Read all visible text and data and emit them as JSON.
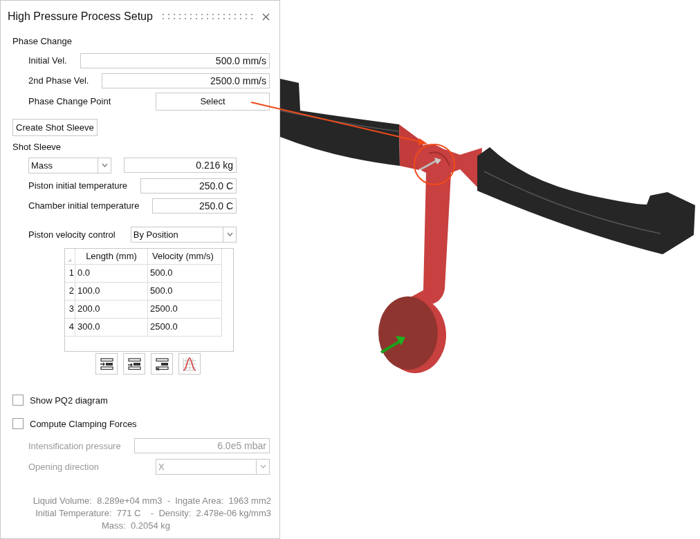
{
  "window": {
    "title": "High Pressure Process Setup"
  },
  "phase_change": {
    "heading": "Phase Change",
    "fields": [
      {
        "label": "Initial Vel.",
        "value": "500.0 mm/s"
      },
      {
        "label": "2nd Phase Vel.",
        "value": "2500.0 mm/s"
      }
    ],
    "point": {
      "label": "Phase Change Point",
      "button": "Select"
    }
  },
  "create_button": "Create Shot Sleeve",
  "shot_sleeve": {
    "heading": "Shot Sleeve",
    "mode": "Mass",
    "mode_value": "0.216 kg",
    "fields": [
      {
        "label": "Piston initial temperature",
        "value": "250.0 C"
      },
      {
        "label": "Chamber initial temperature",
        "value": "250.0 C"
      }
    ],
    "velocity_control": {
      "label": "Piston velocity control",
      "value": "By Position"
    },
    "table": {
      "columns": [
        "Length (mm)",
        "Velocity (mm/s)"
      ],
      "rows": [
        {
          "index": "1",
          "cells": [
            "0.0",
            "500.0"
          ]
        },
        {
          "index": "2",
          "cells": [
            "100.0",
            "500.0"
          ]
        },
        {
          "index": "3",
          "cells": [
            "200.0",
            "2500.0"
          ]
        },
        {
          "index": "4",
          "cells": [
            "300.0",
            "2500.0"
          ]
        }
      ]
    }
  },
  "options": [
    {
      "label": "Show PQ2 diagram",
      "checked": false
    },
    {
      "label": "Compute Clamping Forces",
      "checked": false
    }
  ],
  "clamping": {
    "pressure": {
      "label": "Intensification pressure",
      "value": "6.0e5 mbar",
      "disabled": true
    },
    "direction": {
      "label": "Opening direction",
      "value": "X",
      "disabled": true
    }
  },
  "summary": [
    "Liquid Volume:  8.289e+04 mm3  -  Ingate Area:  1963 mm2",
    "Initial Temperature:  771 C    -  Density:  2.478e-06 kg/mm3",
    "Mass:  0.2054 kg"
  ]
}
